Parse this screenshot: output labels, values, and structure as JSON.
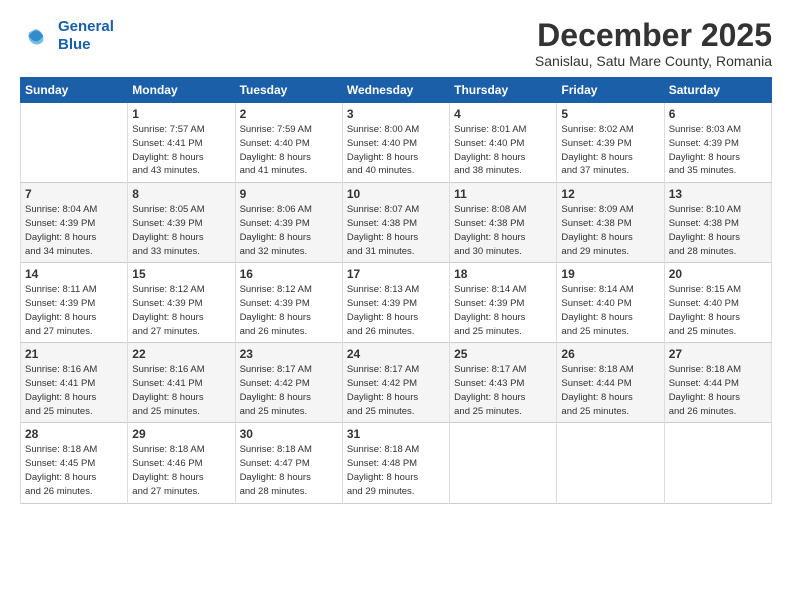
{
  "logo": {
    "line1": "General",
    "line2": "Blue"
  },
  "title": "December 2025",
  "subtitle": "Sanislau, Satu Mare County, Romania",
  "days_header": [
    "Sunday",
    "Monday",
    "Tuesday",
    "Wednesday",
    "Thursday",
    "Friday",
    "Saturday"
  ],
  "weeks": [
    [
      {
        "day": "",
        "info": ""
      },
      {
        "day": "1",
        "info": "Sunrise: 7:57 AM\nSunset: 4:41 PM\nDaylight: 8 hours\nand 43 minutes."
      },
      {
        "day": "2",
        "info": "Sunrise: 7:59 AM\nSunset: 4:40 PM\nDaylight: 8 hours\nand 41 minutes."
      },
      {
        "day": "3",
        "info": "Sunrise: 8:00 AM\nSunset: 4:40 PM\nDaylight: 8 hours\nand 40 minutes."
      },
      {
        "day": "4",
        "info": "Sunrise: 8:01 AM\nSunset: 4:40 PM\nDaylight: 8 hours\nand 38 minutes."
      },
      {
        "day": "5",
        "info": "Sunrise: 8:02 AM\nSunset: 4:39 PM\nDaylight: 8 hours\nand 37 minutes."
      },
      {
        "day": "6",
        "info": "Sunrise: 8:03 AM\nSunset: 4:39 PM\nDaylight: 8 hours\nand 35 minutes."
      }
    ],
    [
      {
        "day": "7",
        "info": "Sunrise: 8:04 AM\nSunset: 4:39 PM\nDaylight: 8 hours\nand 34 minutes."
      },
      {
        "day": "8",
        "info": "Sunrise: 8:05 AM\nSunset: 4:39 PM\nDaylight: 8 hours\nand 33 minutes."
      },
      {
        "day": "9",
        "info": "Sunrise: 8:06 AM\nSunset: 4:39 PM\nDaylight: 8 hours\nand 32 minutes."
      },
      {
        "day": "10",
        "info": "Sunrise: 8:07 AM\nSunset: 4:38 PM\nDaylight: 8 hours\nand 31 minutes."
      },
      {
        "day": "11",
        "info": "Sunrise: 8:08 AM\nSunset: 4:38 PM\nDaylight: 8 hours\nand 30 minutes."
      },
      {
        "day": "12",
        "info": "Sunrise: 8:09 AM\nSunset: 4:38 PM\nDaylight: 8 hours\nand 29 minutes."
      },
      {
        "day": "13",
        "info": "Sunrise: 8:10 AM\nSunset: 4:38 PM\nDaylight: 8 hours\nand 28 minutes."
      }
    ],
    [
      {
        "day": "14",
        "info": "Sunrise: 8:11 AM\nSunset: 4:39 PM\nDaylight: 8 hours\nand 27 minutes."
      },
      {
        "day": "15",
        "info": "Sunrise: 8:12 AM\nSunset: 4:39 PM\nDaylight: 8 hours\nand 27 minutes."
      },
      {
        "day": "16",
        "info": "Sunrise: 8:12 AM\nSunset: 4:39 PM\nDaylight: 8 hours\nand 26 minutes."
      },
      {
        "day": "17",
        "info": "Sunrise: 8:13 AM\nSunset: 4:39 PM\nDaylight: 8 hours\nand 26 minutes."
      },
      {
        "day": "18",
        "info": "Sunrise: 8:14 AM\nSunset: 4:39 PM\nDaylight: 8 hours\nand 25 minutes."
      },
      {
        "day": "19",
        "info": "Sunrise: 8:14 AM\nSunset: 4:40 PM\nDaylight: 8 hours\nand 25 minutes."
      },
      {
        "day": "20",
        "info": "Sunrise: 8:15 AM\nSunset: 4:40 PM\nDaylight: 8 hours\nand 25 minutes."
      }
    ],
    [
      {
        "day": "21",
        "info": "Sunrise: 8:16 AM\nSunset: 4:41 PM\nDaylight: 8 hours\nand 25 minutes."
      },
      {
        "day": "22",
        "info": "Sunrise: 8:16 AM\nSunset: 4:41 PM\nDaylight: 8 hours\nand 25 minutes."
      },
      {
        "day": "23",
        "info": "Sunrise: 8:17 AM\nSunset: 4:42 PM\nDaylight: 8 hours\nand 25 minutes."
      },
      {
        "day": "24",
        "info": "Sunrise: 8:17 AM\nSunset: 4:42 PM\nDaylight: 8 hours\nand 25 minutes."
      },
      {
        "day": "25",
        "info": "Sunrise: 8:17 AM\nSunset: 4:43 PM\nDaylight: 8 hours\nand 25 minutes."
      },
      {
        "day": "26",
        "info": "Sunrise: 8:18 AM\nSunset: 4:44 PM\nDaylight: 8 hours\nand 25 minutes."
      },
      {
        "day": "27",
        "info": "Sunrise: 8:18 AM\nSunset: 4:44 PM\nDaylight: 8 hours\nand 26 minutes."
      }
    ],
    [
      {
        "day": "28",
        "info": "Sunrise: 8:18 AM\nSunset: 4:45 PM\nDaylight: 8 hours\nand 26 minutes."
      },
      {
        "day": "29",
        "info": "Sunrise: 8:18 AM\nSunset: 4:46 PM\nDaylight: 8 hours\nand 27 minutes."
      },
      {
        "day": "30",
        "info": "Sunrise: 8:18 AM\nSunset: 4:47 PM\nDaylight: 8 hours\nand 28 minutes."
      },
      {
        "day": "31",
        "info": "Sunrise: 8:18 AM\nSunset: 4:48 PM\nDaylight: 8 hours\nand 29 minutes."
      },
      {
        "day": "",
        "info": ""
      },
      {
        "day": "",
        "info": ""
      },
      {
        "day": "",
        "info": ""
      }
    ]
  ]
}
